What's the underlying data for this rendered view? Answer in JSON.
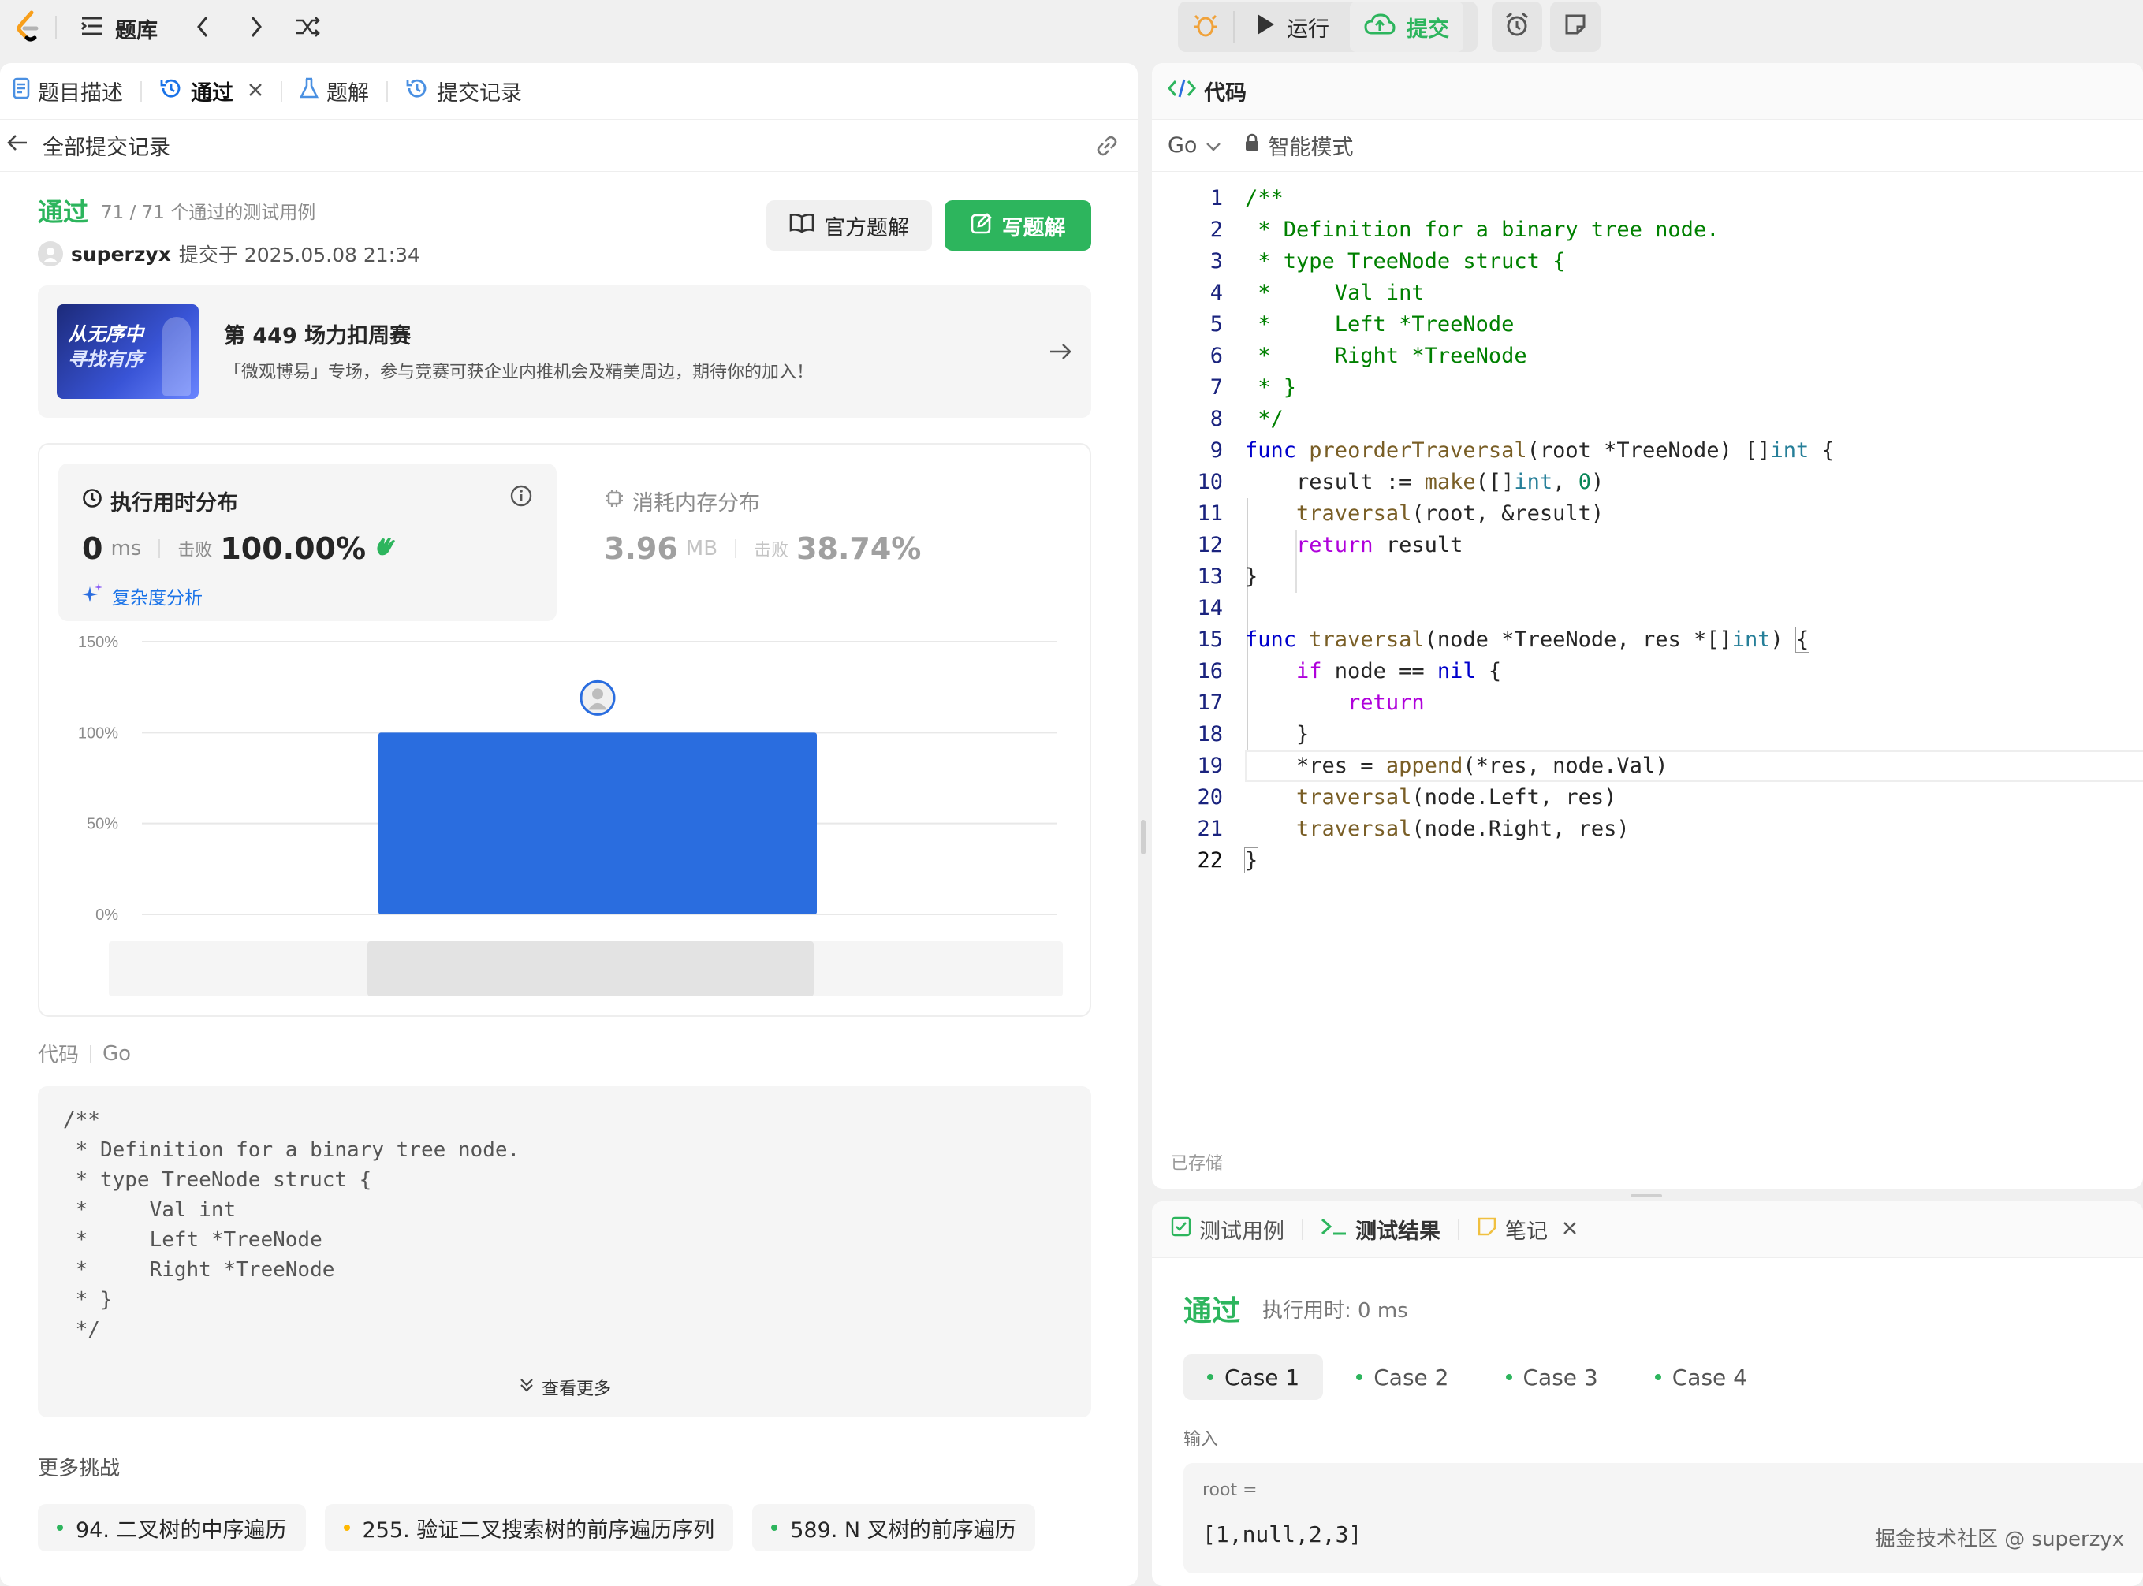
{
  "topbar": {
    "library_label": "题库",
    "run_label": "运行",
    "submit_label": "提交"
  },
  "left": {
    "tabs": {
      "description": "题目描述",
      "passed": "通过",
      "solutions": "题解",
      "submissions": "提交记录"
    },
    "back_label": "全部提交记录",
    "result": {
      "status": "通过",
      "testcases": "71 / 71 个通过的测试用例",
      "user": "superzyx",
      "submitted_at": "提交于 2025.05.08 21:34",
      "official_btn": "官方题解",
      "write_btn": "写题解"
    },
    "banner": {
      "img_line1": "从无序中",
      "img_line2": "寻找有序",
      "title": "第 449 场力扣周赛",
      "desc": "「微观博易」专场，参与竞赛可获企业内推机会及精美周边，期待你的加入！"
    },
    "runtime": {
      "title": "执行用时分布",
      "value": "0",
      "unit": "ms",
      "beats_label": "击败",
      "beats": "100.00%",
      "complexity_link": "复杂度分析"
    },
    "memory": {
      "title": "消耗内存分布",
      "value": "3.96",
      "unit": "MB",
      "beats_label": "击败",
      "beats": "38.74%"
    },
    "chart_data": {
      "type": "bar",
      "categories": [
        "0 ms"
      ],
      "values": [
        100
      ],
      "ylim": [
        0,
        150
      ],
      "yticks": [
        "150%",
        "100%",
        "50%",
        "0%"
      ],
      "grid": true,
      "color": "#2a6ddf"
    },
    "code_header": {
      "label": "代码",
      "lang": "Go"
    },
    "code_preview": [
      "/**",
      " * Definition for a binary tree node.",
      " * type TreeNode struct {",
      " *     Val int",
      " *     Left *TreeNode",
      " *     Right *TreeNode",
      " * }",
      " */"
    ],
    "show_more": "查看更多",
    "more_challenges": {
      "title": "更多挑战",
      "items": [
        {
          "label": "94. 二叉树的中序遍历",
          "color": "#2db55d"
        },
        {
          "label": "255. 验证二叉搜索树的前序遍历序列",
          "color": "#ffb800"
        },
        {
          "label": "589. N 叉树的前序遍历",
          "color": "#2db55d"
        }
      ]
    }
  },
  "editor": {
    "title": "代码",
    "lang": "Go",
    "mode": "智能模式",
    "saved": "已存储",
    "line_numbers": [
      "1",
      "2",
      "3",
      "4",
      "5",
      "6",
      "7",
      "8",
      "9",
      "10",
      "11",
      "12",
      "13",
      "14",
      "15",
      "16",
      "17",
      "18",
      "19",
      "20",
      "21",
      "22"
    ]
  },
  "bottom": {
    "tabs": {
      "testcase": "测试用例",
      "result": "测试结果",
      "notes": "笔记"
    },
    "status": "通过",
    "runtime": "执行用时: 0 ms",
    "cases": [
      "Case 1",
      "Case 2",
      "Case 3",
      "Case 4"
    ],
    "input_label": "输入",
    "var_name": "root =",
    "var_value": "[1,null,2,3]"
  },
  "watermark": "掘金技术社区 @ superzyx",
  "colors": {
    "green": "#2db55d",
    "blue": "#2a6ddf",
    "link_blue": "#1a73e8"
  }
}
